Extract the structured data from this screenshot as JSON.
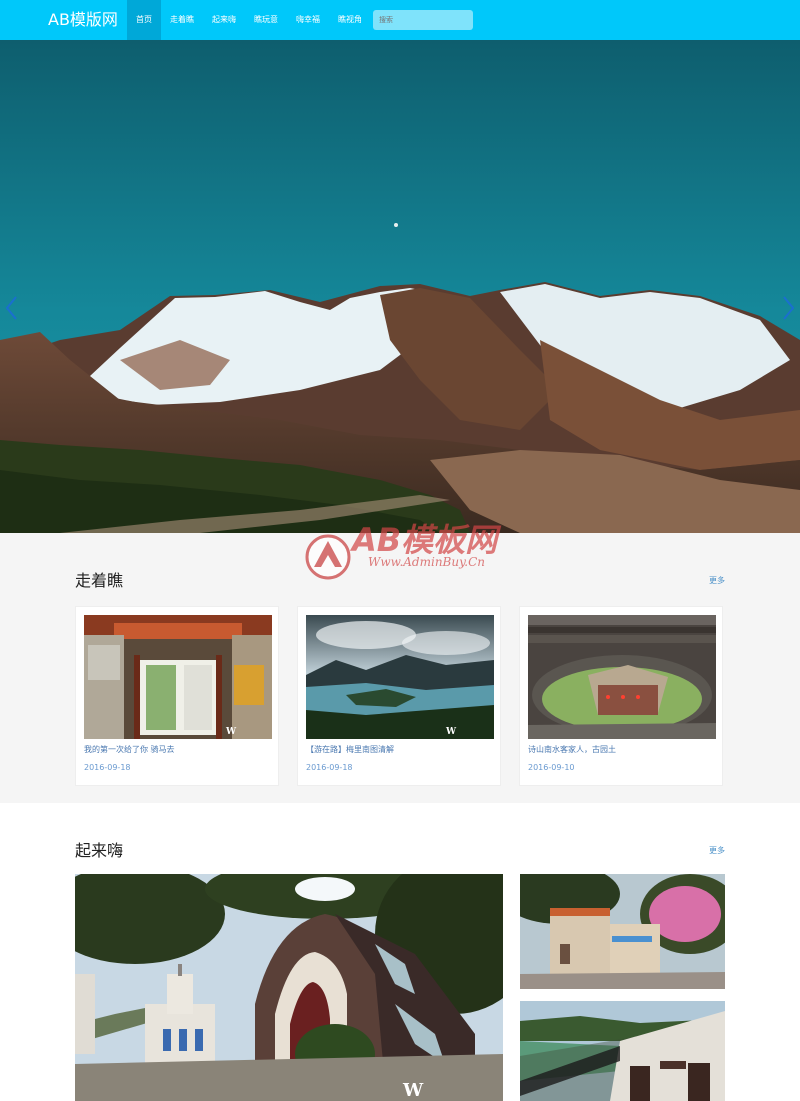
{
  "navbar": {
    "brand": "AB模版网",
    "items": [
      {
        "label": "首页",
        "active": true
      },
      {
        "label": "走着瞧",
        "active": false
      },
      {
        "label": "起来嗨",
        "active": false
      },
      {
        "label": "瞧玩意",
        "active": false
      },
      {
        "label": "嗨幸福",
        "active": false
      },
      {
        "label": "瞧视角",
        "active": false
      }
    ],
    "search_placeholder": "搜索"
  },
  "watermark": {
    "text": "AB模板网",
    "url": "Www.AdminBuy.Cn"
  },
  "section1": {
    "title": "走着瞧",
    "more": "更多",
    "cards": [
      {
        "title": "我的第一次给了你 骑马去",
        "date": "2016-09-18"
      },
      {
        "title": "【游在路】梅里南图清解",
        "date": "2016-09-18"
      },
      {
        "title": "诗山南水客家人，古园土",
        "date": "2016-09-10"
      }
    ]
  },
  "section2": {
    "title": "起来嗨",
    "more": "更多"
  },
  "colors": {
    "nav": "#00c8fa",
    "nav_active": "#00a8d8",
    "link": "#4a78b0"
  }
}
